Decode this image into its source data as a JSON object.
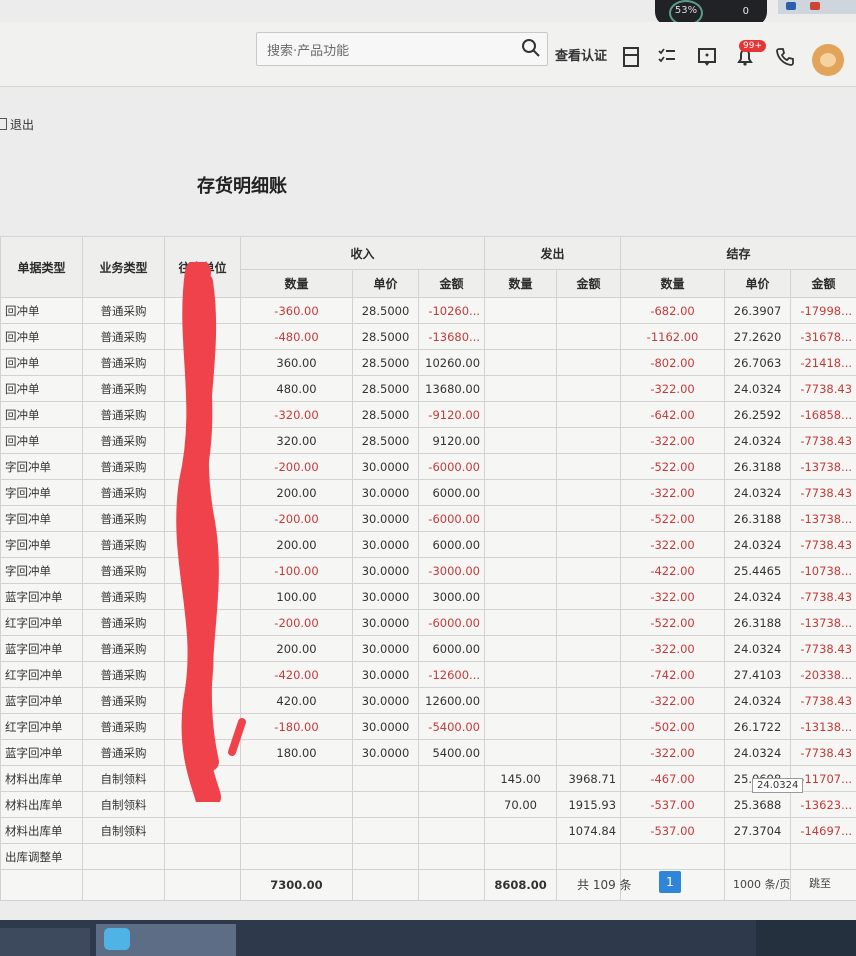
{
  "system": {
    "status_percent": "53%",
    "counter": "0"
  },
  "header": {
    "search_placeholder": "搜索·产品功能",
    "verify_label": "查看认证",
    "notification_badge": "99+",
    "icons": [
      "search-icon",
      "calculator-icon",
      "checklist-icon",
      "message-icon",
      "bell-icon",
      "phone-icon",
      "avatar"
    ]
  },
  "toolbar": {
    "logout_label": "退出"
  },
  "report": {
    "title": "存货明细账"
  },
  "table": {
    "headers": {
      "doc_type": "单据类型",
      "biz_type": "业务类型",
      "partner": "往来单位",
      "in_group": "收入",
      "out_group": "发出",
      "bal_group": "结存",
      "qty": "数量",
      "price": "单价",
      "amount": "金额"
    },
    "rows": [
      {
        "doc": "回冲单",
        "biz": "普通采购",
        "partner": "",
        "in_qty": "-360.00",
        "in_price": "28.5000",
        "in_amt": "-10260...",
        "out_qty": "",
        "out_amt": "",
        "bal_qty": "-682.00",
        "bal_price": "26.3907",
        "bal_amt": "-17998..."
      },
      {
        "doc": "回冲单",
        "biz": "普通采购",
        "partner": "",
        "in_qty": "-480.00",
        "in_price": "28.5000",
        "in_amt": "-13680...",
        "out_qty": "",
        "out_amt": "",
        "bal_qty": "-1162.00",
        "bal_price": "27.2620",
        "bal_amt": "-31678..."
      },
      {
        "doc": "回冲单",
        "biz": "普通采购",
        "partner": "",
        "in_qty": "360.00",
        "in_price": "28.5000",
        "in_amt": "10260.00",
        "out_qty": "",
        "out_amt": "",
        "bal_qty": "-802.00",
        "bal_price": "26.7063",
        "bal_amt": "-21418..."
      },
      {
        "doc": "回冲单",
        "biz": "普通采购",
        "partner": "",
        "in_qty": "480.00",
        "in_price": "28.5000",
        "in_amt": "13680.00",
        "out_qty": "",
        "out_amt": "",
        "bal_qty": "-322.00",
        "bal_price": "24.0324",
        "bal_amt": "-7738.43"
      },
      {
        "doc": "回冲单",
        "biz": "普通采购",
        "partner": "",
        "in_qty": "-320.00",
        "in_price": "28.5000",
        "in_amt": "-9120.00",
        "out_qty": "",
        "out_amt": "",
        "bal_qty": "-642.00",
        "bal_price": "26.2592",
        "bal_amt": "-16858..."
      },
      {
        "doc": "回冲单",
        "biz": "普通采购",
        "partner": "",
        "in_qty": "320.00",
        "in_price": "28.5000",
        "in_amt": "9120.00",
        "out_qty": "",
        "out_amt": "",
        "bal_qty": "-322.00",
        "bal_price": "24.0324",
        "bal_amt": "-7738.43"
      },
      {
        "doc": "字回冲单",
        "biz": "普通采购",
        "partner": "",
        "in_qty": "-200.00",
        "in_price": "30.0000",
        "in_amt": "-6000.00",
        "out_qty": "",
        "out_amt": "",
        "bal_qty": "-522.00",
        "bal_price": "26.3188",
        "bal_amt": "-13738..."
      },
      {
        "doc": "字回冲单",
        "biz": "普通采购",
        "partner": "",
        "in_qty": "200.00",
        "in_price": "30.0000",
        "in_amt": "6000.00",
        "out_qty": "",
        "out_amt": "",
        "bal_qty": "-322.00",
        "bal_price": "24.0324",
        "bal_amt": "-7738.43"
      },
      {
        "doc": "字回冲单",
        "biz": "普通采购",
        "partner": "",
        "in_qty": "-200.00",
        "in_price": "30.0000",
        "in_amt": "-6000.00",
        "out_qty": "",
        "out_amt": "",
        "bal_qty": "-522.00",
        "bal_price": "26.3188",
        "bal_amt": "-13738..."
      },
      {
        "doc": "字回冲单",
        "biz": "普通采购",
        "partner": "",
        "in_qty": "200.00",
        "in_price": "30.0000",
        "in_amt": "6000.00",
        "out_qty": "",
        "out_amt": "",
        "bal_qty": "-322.00",
        "bal_price": "24.0324",
        "bal_amt": "-7738.43"
      },
      {
        "doc": "字回冲单",
        "biz": "普通采购",
        "partner": "",
        "in_qty": "-100.00",
        "in_price": "30.0000",
        "in_amt": "-3000.00",
        "out_qty": "",
        "out_amt": "",
        "bal_qty": "-422.00",
        "bal_price": "25.4465",
        "bal_amt": "-10738..."
      },
      {
        "doc": "蓝字回冲单",
        "biz": "普通采购",
        "partner": "",
        "in_qty": "100.00",
        "in_price": "30.0000",
        "in_amt": "3000.00",
        "out_qty": "",
        "out_amt": "",
        "bal_qty": "-322.00",
        "bal_price": "24.0324",
        "bal_amt": "-7738.43"
      },
      {
        "doc": "红字回冲单",
        "biz": "普通采购",
        "partner": "",
        "in_qty": "-200.00",
        "in_price": "30.0000",
        "in_amt": "-6000.00",
        "out_qty": "",
        "out_amt": "",
        "bal_qty": "-522.00",
        "bal_price": "26.3188",
        "bal_amt": "-13738..."
      },
      {
        "doc": "蓝字回冲单",
        "biz": "普通采购",
        "partner": "",
        "in_qty": "200.00",
        "in_price": "30.0000",
        "in_amt": "6000.00",
        "out_qty": "",
        "out_amt": "",
        "bal_qty": "-322.00",
        "bal_price": "24.0324",
        "bal_amt": "-7738.43"
      },
      {
        "doc": "红字回冲单",
        "biz": "普通采购",
        "partner": "",
        "in_qty": "-420.00",
        "in_price": "30.0000",
        "in_amt": "-12600...",
        "out_qty": "",
        "out_amt": "",
        "bal_qty": "-742.00",
        "bal_price": "27.4103",
        "bal_amt": "-20338..."
      },
      {
        "doc": "蓝字回冲单",
        "biz": "普通采购",
        "partner": "",
        "in_qty": "420.00",
        "in_price": "30.0000",
        "in_amt": "12600.00",
        "out_qty": "",
        "out_amt": "",
        "bal_qty": "-322.00",
        "bal_price": "24.0324",
        "bal_amt": "-7738.43"
      },
      {
        "doc": "红字回冲单",
        "biz": "普通采购",
        "partner": "",
        "in_qty": "-180.00",
        "in_price": "30.0000",
        "in_amt": "-5400.00",
        "out_qty": "",
        "out_amt": "",
        "bal_qty": "-502.00",
        "bal_price": "26.1722",
        "bal_amt": "-13138..."
      },
      {
        "doc": "蓝字回冲单",
        "biz": "普通采购",
        "partner": "",
        "in_qty": "180.00",
        "in_price": "30.0000",
        "in_amt": "5400.00",
        "out_qty": "",
        "out_amt": "",
        "bal_qty": "-322.00",
        "bal_price": "24.0324",
        "bal_amt": "-7738.43"
      },
      {
        "doc": "材料出库单",
        "biz": "自制领料",
        "partner": "",
        "in_qty": "",
        "in_price": "",
        "in_amt": "",
        "out_qty": "145.00",
        "out_amt": "3968.71",
        "bal_qty": "-467.00",
        "bal_price": "25.0698",
        "bal_amt": "-11707..."
      },
      {
        "doc": "材料出库单",
        "biz": "自制领料",
        "partner": "",
        "in_qty": "",
        "in_price": "",
        "in_amt": "",
        "out_qty": "70.00",
        "out_amt": "1915.93",
        "bal_qty": "-537.00",
        "bal_price": "25.3688",
        "bal_amt": "-13623..."
      },
      {
        "doc": "材料出库单",
        "biz": "自制领料",
        "partner": "",
        "in_qty": "",
        "in_price": "",
        "in_amt": "",
        "out_qty": "",
        "out_amt": "1074.84",
        "bal_qty": "-537.00",
        "bal_price": "27.3704",
        "bal_amt": "-14697..."
      },
      {
        "doc": "出库调整单",
        "biz": "",
        "partner": "",
        "in_qty": "",
        "in_price": "",
        "in_amt": "",
        "out_qty": "",
        "out_amt": "",
        "bal_qty": "",
        "bal_price": "",
        "bal_amt": ""
      }
    ],
    "totals": {
      "in_qty": "7300.00",
      "out_qty": "8608.00"
    },
    "tooltip": "24.0324"
  },
  "pager": {
    "total_label": "共 109 条",
    "current_page": "1",
    "page_size": "1000 条/页",
    "jump_label": "跳至"
  },
  "colors": {
    "negative": "#c23b3b",
    "accent": "#2f86d9",
    "redaction": "#f0424a"
  }
}
